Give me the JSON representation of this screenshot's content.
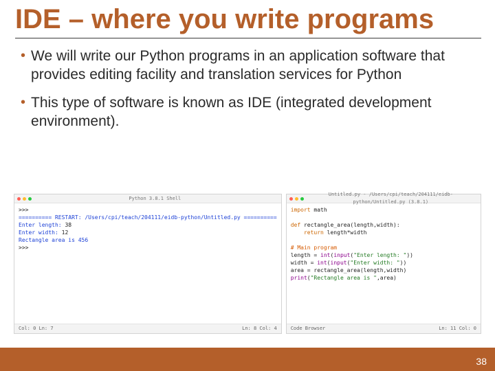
{
  "title": "IDE – where you write programs",
  "bullets": [
    "We will write our Python programs in an application software that provides editing facility and translation services for Python",
    "This type of software is known as IDE (integrated development environment)."
  ],
  "shell": {
    "title": "Python 3.8.1 Shell",
    "prompt1": ">>>",
    "restart_line": "========== RESTART: /Users/cpi/teach/204111/eidb-python/Untitled.py ==========",
    "line1_label": "Enter length: ",
    "line1_val": "38",
    "line2_label": "Enter width: ",
    "line2_val": "12",
    "line3": "Rectangle area is 456",
    "prompt2": ">>>",
    "status_left": "Col: 0  Ln: 7",
    "status_right": "Ln: 8  Col: 4"
  },
  "editor": {
    "title": "Untitled.py - /Users/cpi/teach/204111/eidb-python/Untitled.py (3.8.1)",
    "l1a": "import",
    "l1b": " math",
    "l3a": "def",
    "l3b": " rectangle_area(length,width):",
    "l4a": "    return",
    "l4b": " length*width",
    "l6": "# Main program",
    "l7a": "length = ",
    "l7b": "int",
    "l7c": "(",
    "l7d": "input",
    "l7e": "(",
    "l7f": "\"Enter length: \"",
    "l7g": "))",
    "l8a": "width = ",
    "l8b": "int",
    "l8c": "(",
    "l8d": "input",
    "l8e": "(",
    "l8f": "\"Enter width: \"",
    "l8g": "))",
    "l9": "area = rectangle_area(length,width)",
    "l10a": "print",
    "l10b": "(",
    "l10c": "\"Rectangle area is \"",
    "l10d": ",area)",
    "status_left": "Code Browser",
    "status_right": "Ln: 11  Col: 0"
  },
  "page_number": "38",
  "colors": {
    "accent": "#b45f2a"
  }
}
